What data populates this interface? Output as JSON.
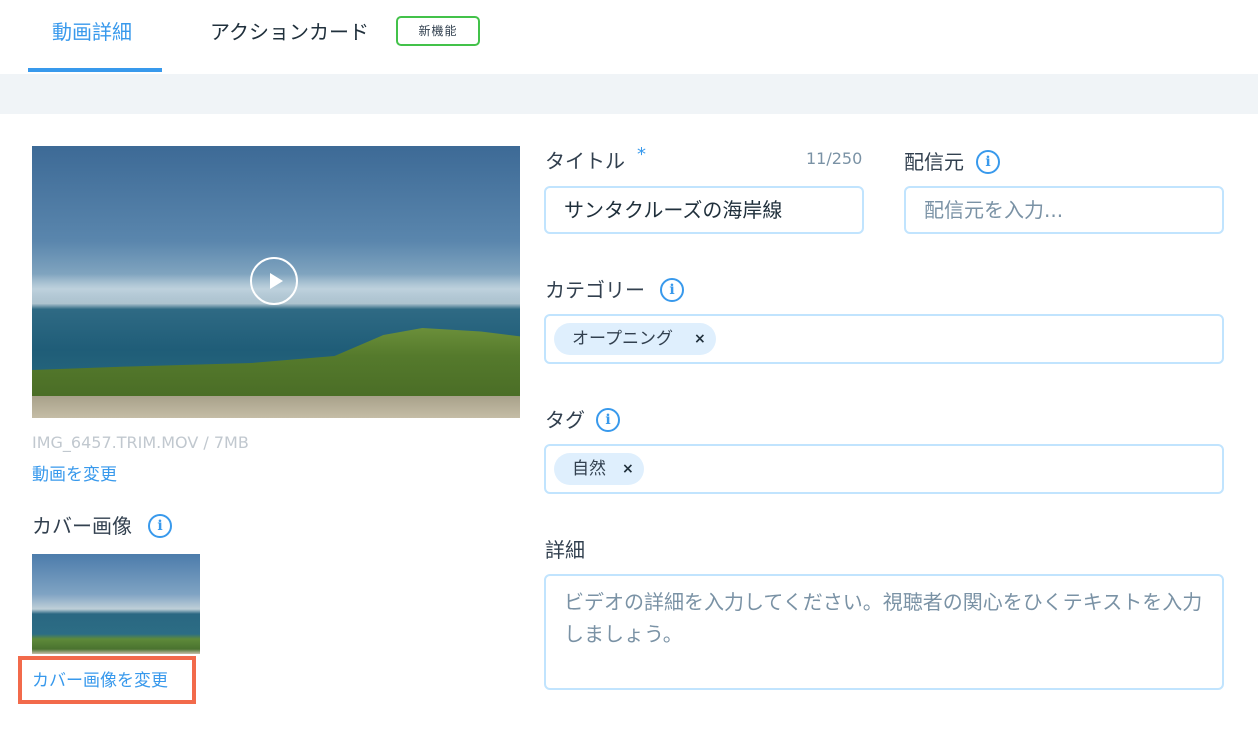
{
  "tabs": {
    "details": "動画詳細",
    "action_cards": "アクションカード",
    "new_badge": "新機能"
  },
  "video": {
    "file_info": "IMG_6457.TRIM.MOV / 7MB",
    "change_link": "動画を変更"
  },
  "cover": {
    "label": "カバー画像",
    "change_link": "カバー画像を変更"
  },
  "title_field": {
    "label": "タイトル",
    "required_mark": "*",
    "counter": "11/250",
    "value": "サンタクルーズの海岸線"
  },
  "source_field": {
    "label": "配信元",
    "placeholder": "配信元を入力..."
  },
  "category_field": {
    "label": "カテゴリー",
    "chips": [
      "オープニング"
    ]
  },
  "tag_field": {
    "label": "タグ",
    "chips": [
      "自然"
    ]
  },
  "description_field": {
    "label": "詳細",
    "placeholder": "ビデオの詳細を入力してください。視聴者の関心をひくテキストを入力しましょう。"
  },
  "icons": {
    "info": "info-icon",
    "play": "play-icon",
    "remove": "×"
  },
  "colors": {
    "accent": "#3899ec",
    "new_badge_border": "#43c24a",
    "highlight": "#f26a4b",
    "field_border": "#c1e4fe",
    "chip_bg": "#dfeffd"
  }
}
